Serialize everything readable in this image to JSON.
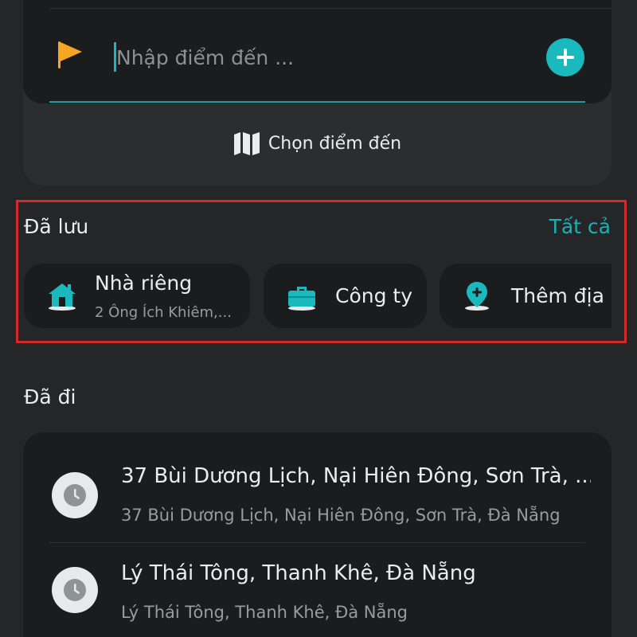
{
  "destination": {
    "placeholder": "Nhập điểm đến ...",
    "choose_label": "Chọn điểm đến",
    "accent_color": "#19b9bd",
    "flag_color": "#f5a623"
  },
  "saved": {
    "title": "Đã lưu",
    "see_all": "Tất cả",
    "items": [
      {
        "icon": "house-icon",
        "title": "Nhà riêng",
        "subtitle": "2 Ông Ích Khiêm,..."
      },
      {
        "icon": "briefcase-icon",
        "title": "Công ty"
      },
      {
        "icon": "add-location-pin-icon",
        "title": "Thêm địa c"
      }
    ]
  },
  "history": {
    "title": "Đã đi",
    "items": [
      {
        "icon": "clock-icon",
        "title": "37 Bùi Dương Lịch, Nại Hiên Đông, Sơn Trà, ...",
        "subtitle": "37 Bùi Dương Lịch, Nại Hiên Đông, Sơn Trà, Đà Nẵng"
      },
      {
        "icon": "clock-icon",
        "title": "Lý Thái Tông, Thanh Khê, Đà Nẵng",
        "subtitle": "Lý Thái Tông, Thanh Khê, Đà Nẵng"
      }
    ]
  }
}
